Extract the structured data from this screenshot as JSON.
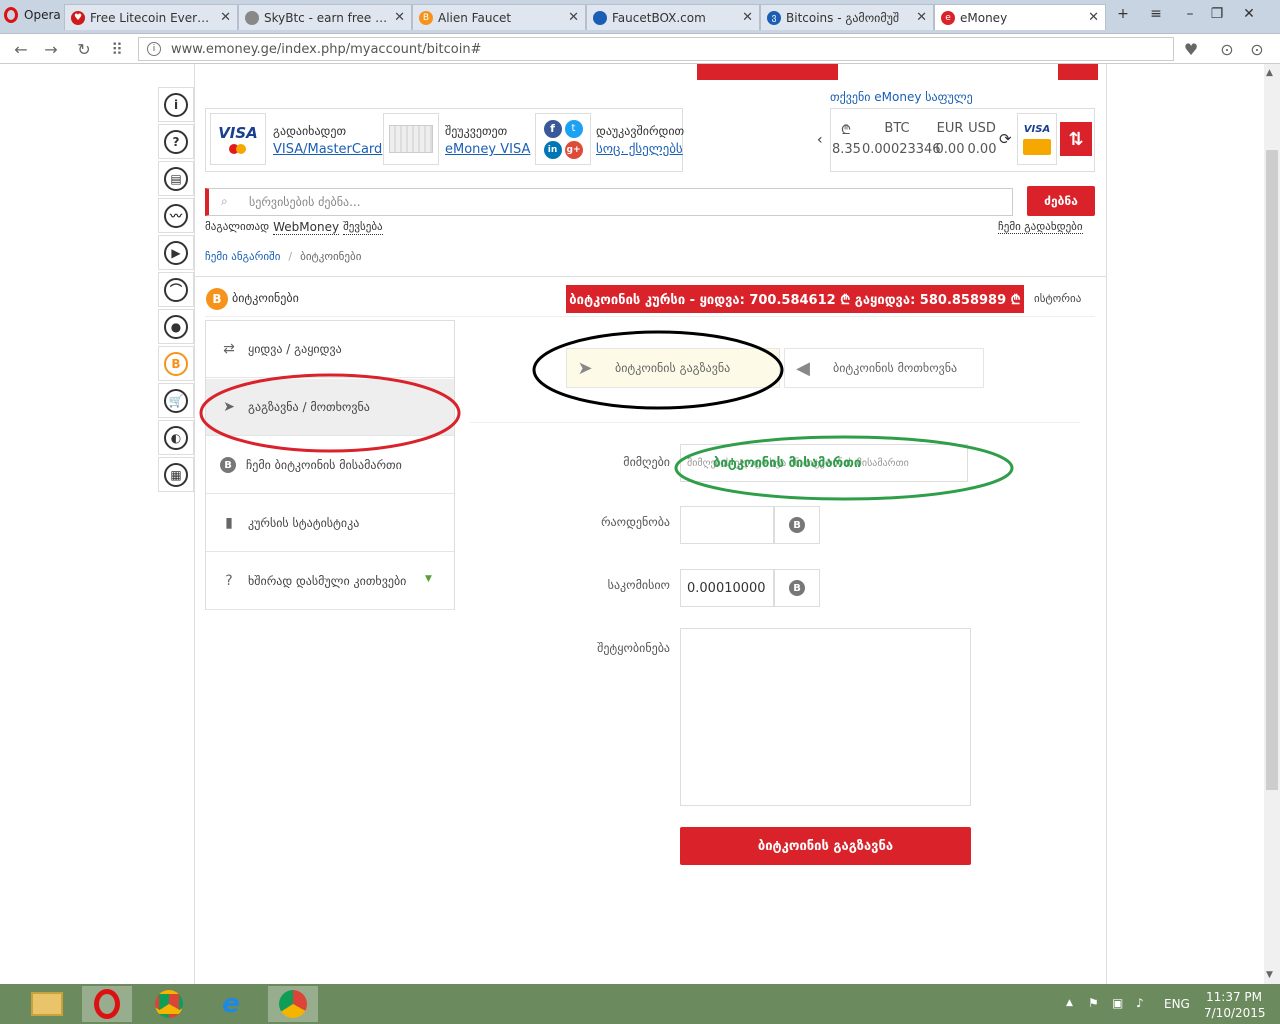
{
  "browser": {
    "opera_label": "Opera",
    "tabs": [
      {
        "label": "Free Litecoin Every Ho",
        "color": "#d11a1a",
        "glyph": "♥"
      },
      {
        "label": "SkyBtc - earn free bitc",
        "color": "#888888",
        "glyph": ""
      },
      {
        "label": "Alien Faucet",
        "color": "#f7931a",
        "glyph": "B"
      },
      {
        "label": "FaucetBOX.com",
        "color": "#1a5fb4",
        "glyph": ""
      },
      {
        "label": "Bitcoins - გამოიმუშ",
        "color": "#1a5fb4",
        "glyph": "ვ"
      },
      {
        "label": "eMoney",
        "color": "#d9222a",
        "glyph": "e"
      }
    ],
    "url": "www.emoney.ge/index.php/myaccount/bitcoin#"
  },
  "header": {
    "wallet_link": "თქვენი eMoney საფულე",
    "payments": [
      {
        "small": "გადაიხადეთ",
        "link": "VISA/MasterCard"
      },
      {
        "small": "შეუკვეთეთ",
        "link": "eMoney VISA"
      },
      {
        "small": "დაუკავშირდით",
        "link": "სოც. ქსელებს"
      }
    ],
    "currencies": {
      "gel_symbol": "₾",
      "gel_value": "8.35",
      "btc_label": "BTC",
      "btc_value": "0.00023346",
      "eur_label": "EUR",
      "eur_value": "0.00",
      "usd_label": "USD",
      "usd_value": "0.00"
    }
  },
  "search": {
    "placeholder": "სერვისების ძებნა...",
    "button": "ძებნა",
    "example_prefix": "მაგალითად",
    "example_term": "WebMoney",
    "example_suffix": "შევსება",
    "my_payments": "ჩემი გადახდები"
  },
  "breadcrumb": {
    "root": "ჩემი ანგარიში",
    "sep": "/",
    "current": "ბიტკოინები"
  },
  "bitcoin": {
    "title": "ბიტკოინები",
    "rate_text": "ბიტკოინის კურსი - ყიდვა: 700.584612 ₾   გაყიდვა: 580.858989 ₾",
    "history": "ისტორია"
  },
  "menu": [
    {
      "label": "ყიდვა / გაყიდვა",
      "icon": "⇄"
    },
    {
      "label": "გაგზავნა / მოთხოვნა",
      "icon": "➤"
    },
    {
      "label": "ჩემი ბიტკოინის მისამართი",
      "icon": "B"
    },
    {
      "label": "კურსის სტატისტიკა",
      "icon": "▮"
    },
    {
      "label": "ხშირად დასმული კითხვები",
      "icon": "?"
    }
  ],
  "send_tabs": {
    "send": "ბიტკოინის გაგზავნა",
    "request": "ბიტკოინის მოთხოვნა"
  },
  "form": {
    "recipient_label": "მიმღები",
    "recipient_placeholder": "მიმღების ელ.ფოსტა ან ბიტკოინის მისამართი",
    "recipient_annotation": "ბიტკოინის მისამართი",
    "amount_label": "რაოდენობა",
    "amount_value": "",
    "fee_label": "საკომისიო",
    "fee_value": "0.00010000",
    "message_label": "შეტყობინება",
    "submit": "ბიტკოინის გაგზავნა"
  },
  "taskbar": {
    "lang": "ENG",
    "time": "11:37 PM",
    "date": "7/10/2015"
  }
}
